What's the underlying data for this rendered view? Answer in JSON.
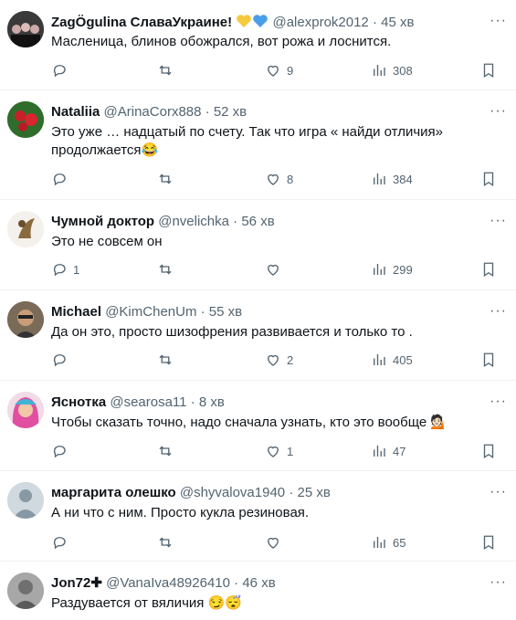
{
  "colors": {
    "muted": "#536471",
    "divider": "#eff3f4",
    "heart_yellow": "#f7c83e",
    "heart_blue": "#4a9ee8"
  },
  "tweets": [
    {
      "name": "ZagÖgulina СлаваУкраине!",
      "handle": "@alexprok2012",
      "time": "45 хв",
      "text": "Масленица, блинов обожрался, вот рожа и лоснится.",
      "replies": "",
      "reposts": "",
      "likes": "9",
      "views": "308"
    },
    {
      "name": "Nataliia",
      "handle": "@ArinaCorx888",
      "time": "52 хв",
      "text": "Это уже … надцатый по счету. Так что игра « найди отличия» продолжается😂",
      "replies": "",
      "reposts": "",
      "likes": "8",
      "views": "384"
    },
    {
      "name": "Чумной доктор",
      "handle": "@nvelichka",
      "time": "56 хв",
      "text": "Это не совсем он",
      "replies": "1",
      "reposts": "",
      "likes": "",
      "views": "299"
    },
    {
      "name": "Michael",
      "handle": "@KimChenUm",
      "time": "55 хв",
      "text": "Да он это, просто шизофрения развивается и только то .",
      "replies": "",
      "reposts": "",
      "likes": "2",
      "views": "405"
    },
    {
      "name": "Яснотка",
      "handle": "@searosa11",
      "time": "8 хв",
      "text": "Чтобы сказать точно, надо сначала узнать, кто это вообще 💁🏻",
      "replies": "",
      "reposts": "",
      "likes": "1",
      "views": "47"
    },
    {
      "name": "маргарита олешко",
      "handle": "@shyvalova1940",
      "time": "25 хв",
      "text": "А ни что с ним. Просто кукла резиновая.",
      "replies": "",
      "reposts": "",
      "likes": "",
      "views": "65"
    },
    {
      "name": "Jon72✚",
      "handle": "@VanaIva48926410",
      "time": "46 хв",
      "text": "Раздувается от вяличия 😏😴",
      "replies": "",
      "reposts": "",
      "likes": "",
      "views": ""
    }
  ]
}
